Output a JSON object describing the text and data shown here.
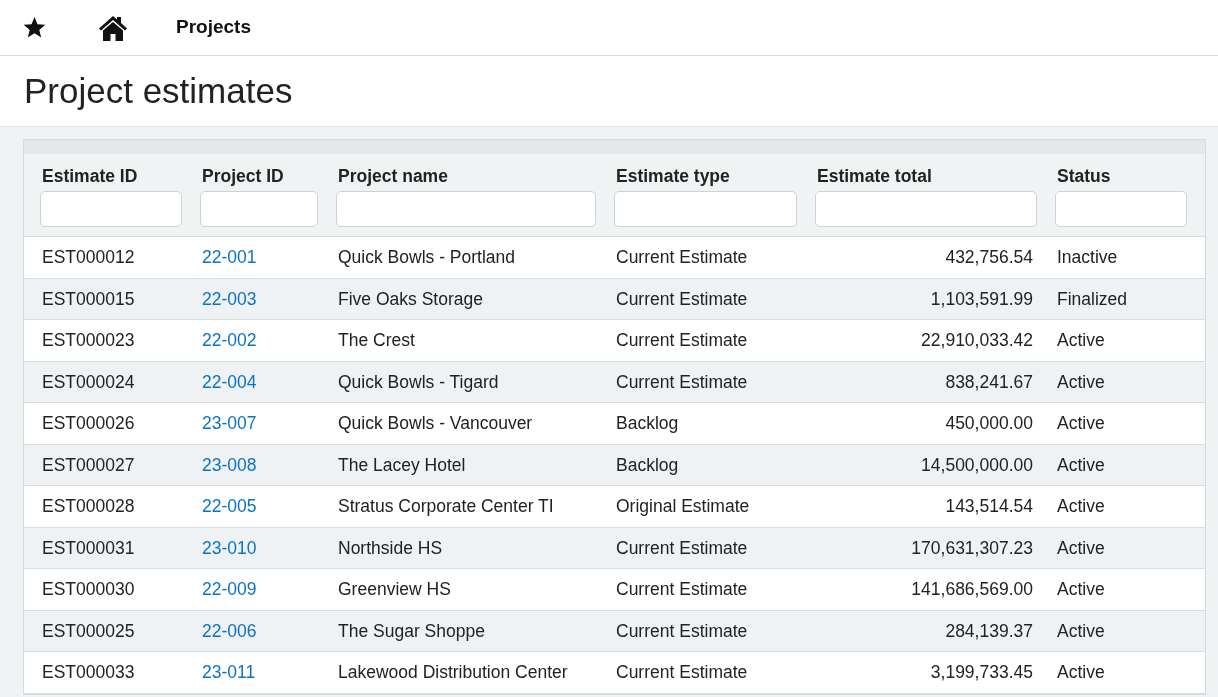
{
  "nav": {
    "title": "Projects"
  },
  "page": {
    "title": "Project estimates"
  },
  "table": {
    "columns": [
      {
        "label": "Estimate ID"
      },
      {
        "label": "Project ID"
      },
      {
        "label": "Project name"
      },
      {
        "label": "Estimate type"
      },
      {
        "label": "Estimate total"
      },
      {
        "label": "Status"
      }
    ],
    "rows": [
      {
        "estimate_id": "EST000012",
        "project_id": "22-001",
        "project_name": "Quick Bowls - Portland",
        "estimate_type": "Current Estimate",
        "estimate_total": "432,756.54",
        "status": "Inactive"
      },
      {
        "estimate_id": "EST000015",
        "project_id": "22-003",
        "project_name": "Five Oaks Storage",
        "estimate_type": "Current Estimate",
        "estimate_total": "1,103,591.99",
        "status": "Finalized"
      },
      {
        "estimate_id": "EST000023",
        "project_id": "22-002",
        "project_name": "The Crest",
        "estimate_type": "Current Estimate",
        "estimate_total": "22,910,033.42",
        "status": "Active"
      },
      {
        "estimate_id": "EST000024",
        "project_id": "22-004",
        "project_name": "Quick Bowls - Tigard",
        "estimate_type": "Current Estimate",
        "estimate_total": "838,241.67",
        "status": "Active"
      },
      {
        "estimate_id": "EST000026",
        "project_id": "23-007",
        "project_name": "Quick Bowls - Vancouver",
        "estimate_type": "Backlog",
        "estimate_total": "450,000.00",
        "status": "Active"
      },
      {
        "estimate_id": "EST000027",
        "project_id": "23-008",
        "project_name": "The Lacey Hotel",
        "estimate_type": "Backlog",
        "estimate_total": "14,500,000.00",
        "status": "Active"
      },
      {
        "estimate_id": "EST000028",
        "project_id": "22-005",
        "project_name": "Stratus Corporate Center TI",
        "estimate_type": "Original Estimate",
        "estimate_total": "143,514.54",
        "status": "Active"
      },
      {
        "estimate_id": "EST000031",
        "project_id": "23-010",
        "project_name": "Northside HS",
        "estimate_type": "Current Estimate",
        "estimate_total": "170,631,307.23",
        "status": "Active"
      },
      {
        "estimate_id": "EST000030",
        "project_id": "22-009",
        "project_name": "Greenview HS",
        "estimate_type": "Current Estimate",
        "estimate_total": "141,686,569.00",
        "status": "Active"
      },
      {
        "estimate_id": "EST000025",
        "project_id": "22-006",
        "project_name": "The Sugar Shoppe",
        "estimate_type": "Current Estimate",
        "estimate_total": "284,139.37",
        "status": "Active"
      },
      {
        "estimate_id": "EST000033",
        "project_id": "23-011",
        "project_name": "Lakewood Distribution Center",
        "estimate_type": "Current Estimate",
        "estimate_total": "3,199,733.45",
        "status": "Active"
      }
    ]
  }
}
